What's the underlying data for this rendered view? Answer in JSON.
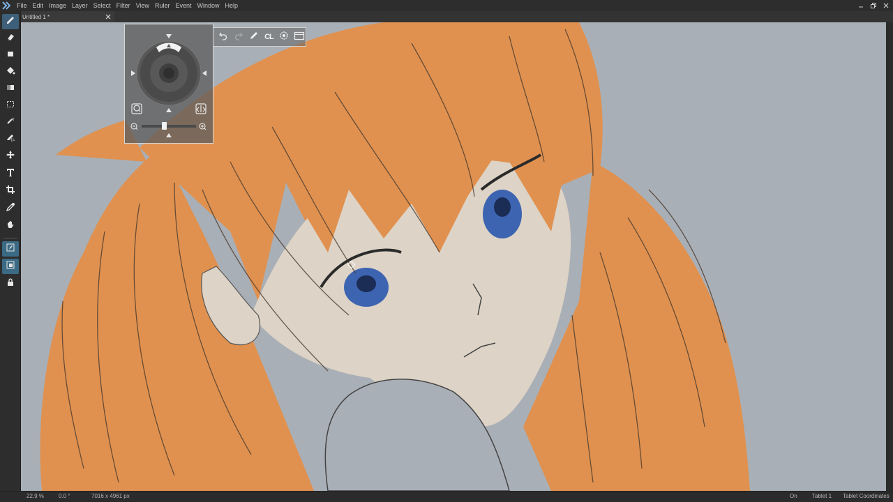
{
  "menubar": {
    "items": [
      "File",
      "Edit",
      "Image",
      "Layer",
      "Select",
      "Filter",
      "View",
      "Ruler",
      "Event",
      "Window",
      "Help"
    ]
  },
  "tabs": [
    {
      "title": "Untitled 1 *"
    }
  ],
  "toolbar": {
    "tools": [
      "brush-icon",
      "eraser-icon",
      "rectangle-icon",
      "fill-bucket-icon",
      "gradient-icon",
      "rect-select-icon",
      "magic-wand-icon",
      "brush-select-icon",
      "move-icon",
      "text-icon",
      "crop-icon",
      "eyedropper-icon",
      "hand-icon",
      "pen-pressure-icon",
      "layer-mode-icon",
      "lock-icon"
    ],
    "active_tool": "brush-icon"
  },
  "navigator_toolbar": {
    "cl_label": "CL",
    "buttons": [
      "undo-icon",
      "redo-icon",
      "pen-icon",
      "cl-button",
      "settings-icon",
      "window-icon"
    ]
  },
  "status": {
    "zoom": "22.9 %",
    "rotation": "0.0 °",
    "size": "7016 x 4961 px",
    "tablet_state": "On",
    "tablet_name": "Tablet 1",
    "coords_mode": "Tablet Coordinates"
  },
  "colors": {
    "canvas_bg": "#a9afb6",
    "hair": "#e0914f",
    "skin": "#ddd3c6",
    "eye": "#3d64b0",
    "accent": "#3d5f79"
  }
}
